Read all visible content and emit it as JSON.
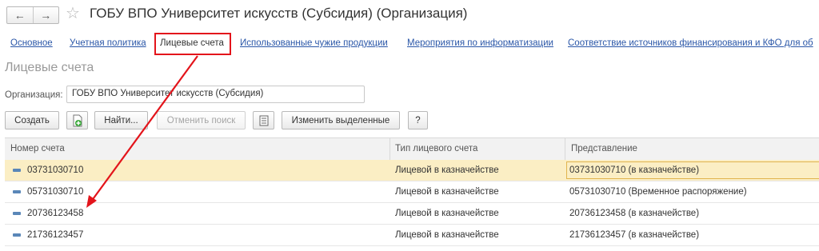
{
  "window": {
    "title": "ГОБУ ВПО Университет искусств (Субсидия) (Организация)",
    "back_icon": "back-arrow-icon",
    "forward_icon": "forward-arrow-icon",
    "favorite_icon": "star-icon"
  },
  "tabs": [
    {
      "label": "Основное"
    },
    {
      "label": "Учетная политика"
    },
    {
      "label": "Лицевые счета"
    },
    {
      "label": "Использованные чужие продукции"
    },
    {
      "label": "Мероприятия по информатизации"
    },
    {
      "label": "Соответствие источников финансирования и КФО для об"
    }
  ],
  "section_title": "Лицевые счета",
  "organization": {
    "label": "Организация:",
    "value": "ГОБУ ВПО Университет искусств (Субсидия)"
  },
  "toolbar": {
    "create": "Создать",
    "find": "Найти...",
    "cancel_search": "Отменить поиск",
    "change_selected": "Изменить выделенные",
    "help": "?"
  },
  "table": {
    "columns": [
      "Номер счета",
      "Тип лицевого счета",
      "Представление"
    ],
    "rows": [
      {
        "number": "03731030710",
        "type": "Лицевой в казначействе",
        "presentation": "03731030710 (в казначействе)"
      },
      {
        "number": "05731030710",
        "type": "Лицевой в казначействе",
        "presentation": "05731030710 (Временное распоряжение)"
      },
      {
        "number": "20736123458",
        "type": "Лицевой в казначействе",
        "presentation": "20736123458 (в казначействе)"
      },
      {
        "number": "21736123457",
        "type": "Лицевой в казначействе",
        "presentation": "21736123457 (в казначействе)"
      }
    ]
  },
  "colors": {
    "annotation": "#e3141b",
    "link": "#2b57a8",
    "selected_row": "#fbeec4"
  }
}
